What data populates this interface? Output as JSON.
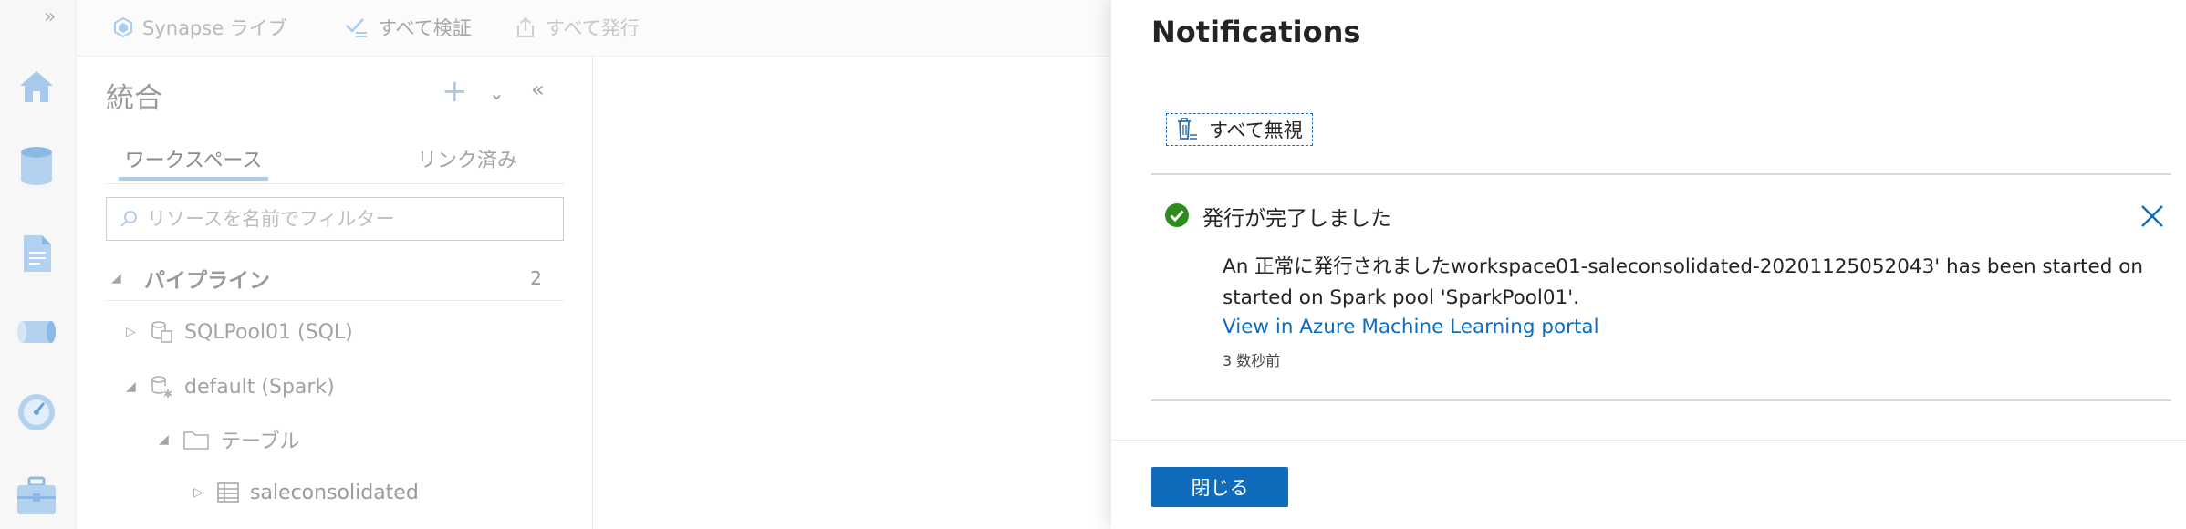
{
  "rail": {
    "expand_icon": "double-chevron-right-icon",
    "items": [
      {
        "name": "home",
        "icon": "home-icon"
      },
      {
        "name": "data",
        "icon": "database-icon"
      },
      {
        "name": "develop",
        "icon": "document-icon"
      },
      {
        "name": "integrate",
        "icon": "pipeline-icon"
      },
      {
        "name": "monitor",
        "icon": "monitor-gauge-icon"
      },
      {
        "name": "manage",
        "icon": "toolbox-icon"
      }
    ]
  },
  "toolbar": {
    "library_label": "Synapse ライブ",
    "validate_all_label": "すべて検証",
    "publish_all_label": "すべて発行"
  },
  "explorer": {
    "title": "統合",
    "tabs": [
      "ワークスペース",
      "リンク済み"
    ],
    "active_tab": "ワークスペース",
    "filter_placeholder": "リソースを名前でフィルター",
    "section": {
      "label": "パイプライン",
      "count": "2"
    },
    "tree": [
      {
        "label": "SQLPool01 (SQL)"
      },
      {
        "label": "default (Spark)"
      },
      {
        "label": "テーブル"
      },
      {
        "label": "saleconsolidated"
      }
    ]
  },
  "notifications": {
    "title": "Notifications",
    "dismiss_all_label": "すべて無視",
    "item": {
      "title": "発行が完了しました",
      "message_line1": "An 正常に発行されましたworkspace01-saleconsolidated-20201125052043' has been started on",
      "message_line2": "started on Spark pool 'SparkPool01'.",
      "link_text": "View in Azure Machine Learning portal",
      "time": "3 数秒前",
      "status": "success"
    },
    "close_label": "閉じる"
  },
  "colors": {
    "accent": "#0f6cbd",
    "success": "#2e8b1e",
    "muted_text": "#a2a2a2"
  }
}
